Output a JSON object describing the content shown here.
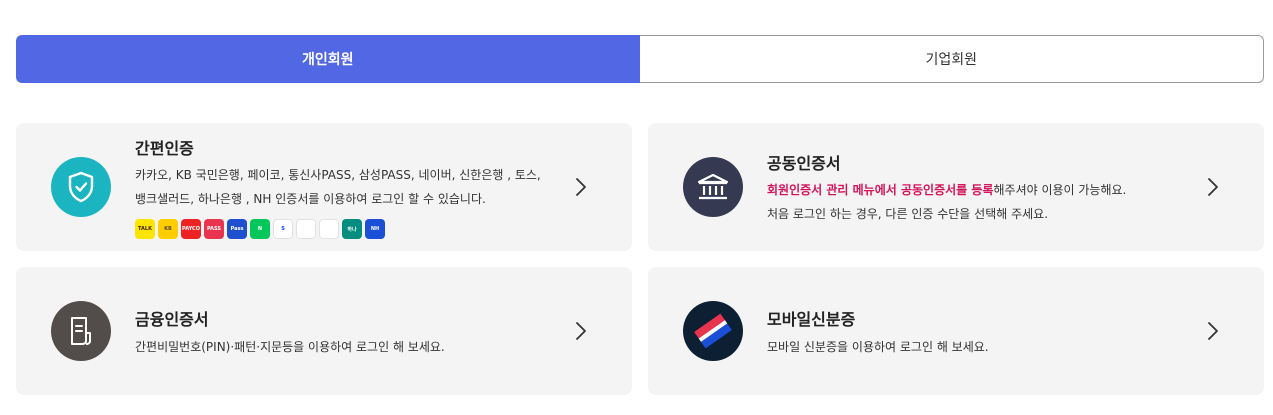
{
  "tabs": {
    "personal": "개인회원",
    "business": "기업회원"
  },
  "cards": {
    "simple": {
      "title": "간편인증",
      "desc_line1": "카카오, KB 국민은행, 페이코, 통신사PASS, 삼성PASS, 네이버, 신한은행 , 토스,",
      "desc_line2": "뱅크샐러드, 하나은행 , NH 인증서를 이용하여 로그인 할 수 있습니다.",
      "icon": "shield-check-icon",
      "color": "#1bb5c2",
      "providers": [
        {
          "icon": "kakao-logo",
          "color": "#fee500",
          "text": "TALK",
          "textColor": "#3c1e1e"
        },
        {
          "icon": "kb-logo",
          "color": "#ffcd00",
          "text": "KB",
          "textColor": "#554b3f"
        },
        {
          "icon": "payco-logo",
          "color": "#ee2222",
          "text": "PAYCO",
          "textColor": "#ffffff"
        },
        {
          "icon": "telecom-pass-logo",
          "color": "#e8344e",
          "text": "PASS",
          "textColor": "#ffffff"
        },
        {
          "icon": "samsung-pass-logo",
          "color": "#1d4fcf",
          "text": "Pass",
          "textColor": "#ffffff"
        },
        {
          "icon": "naver-logo",
          "color": "#03c75a",
          "text": "N",
          "textColor": "#ffffff"
        },
        {
          "icon": "shinhan-logo",
          "color": "#ffffff",
          "text": "S",
          "textColor": "#0046ff"
        },
        {
          "icon": "toss-logo",
          "color": "#ffffff",
          "text": "",
          "textColor": "#0064ff"
        },
        {
          "icon": "banksalad-logo",
          "color": "#ffffff",
          "text": "",
          "textColor": "#00c07f"
        },
        {
          "icon": "hana-logo",
          "color": "#008c7e",
          "text": "하나",
          "textColor": "#ffffff"
        },
        {
          "icon": "nh-logo",
          "color": "#1b4fd8",
          "text": "NH",
          "textColor": "#ffffff"
        }
      ]
    },
    "joint": {
      "title": "공동인증서",
      "desc_highlight": "회원인증서 관리 메뉴에서 공동인증서를 등록",
      "desc_line1_rest": "해주셔야 이용이 가능해요.",
      "desc_line2": "처음 로그인 하는 경우, 다른 인증 수단을 선택해 주세요.",
      "icon": "bank-icon",
      "color": "#353a52",
      "highlight_color": "#d4145a"
    },
    "financial": {
      "title": "금융인증서",
      "desc_line1": "간편비밀번호(PIN)·패턴·지문등을 이용하여 로그인 해 보세요.",
      "icon": "document-icon",
      "color": "#524d4b"
    },
    "mobile_id": {
      "title": "모바일신분증",
      "desc_line1": "모바일 신분증을 이용하여 로그인 해 보세요.",
      "icon": "mobile-id-icon",
      "color": "#0d1f33"
    }
  },
  "accent": "#5167e3"
}
